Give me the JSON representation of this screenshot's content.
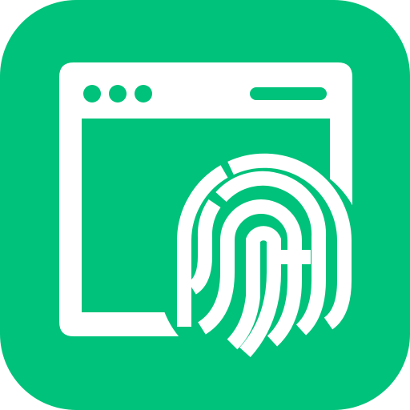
{
  "app_icon": {
    "icon": "browser-fingerprint-icon",
    "colors": {
      "background": "#00C27A",
      "foreground": "#FFFFFF"
    },
    "window": {
      "dots": [
        "dot-1",
        "dot-2",
        "dot-3"
      ],
      "address_bar": "address-bar"
    }
  }
}
